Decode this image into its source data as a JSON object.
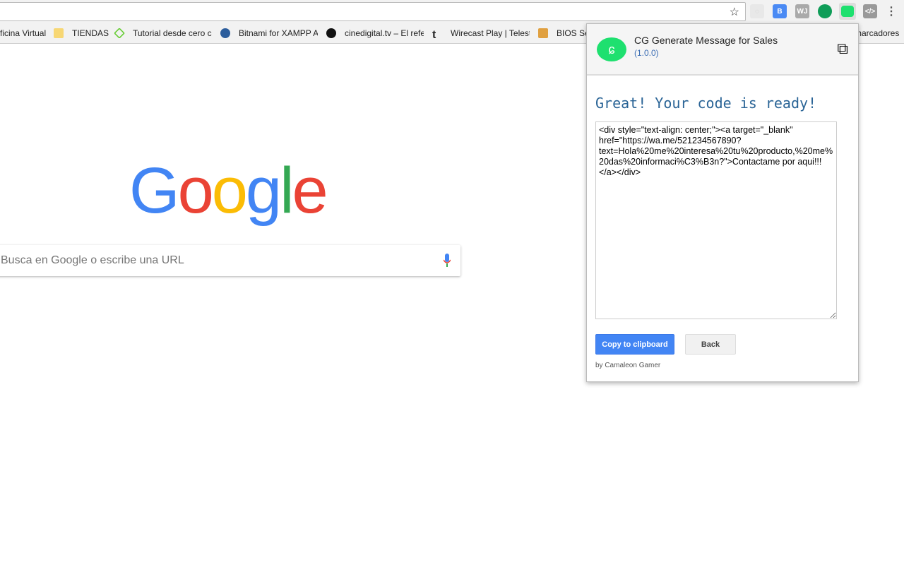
{
  "bookmarks": [
    {
      "label": "ficina Virtual",
      "icon": "bookmark-icon"
    },
    {
      "label": "TIENDAS",
      "icon": "folder-icon"
    },
    {
      "label": "Tutorial desde cero c",
      "icon": "site-icon"
    },
    {
      "label": "Bitnami for XAMPP A",
      "icon": "bitnami-icon"
    },
    {
      "label": "cinedigital.tv – El refe",
      "icon": "site-icon"
    },
    {
      "label": "Wirecast Play | Telest",
      "icon": "telestream-icon"
    },
    {
      "label": "BIOS Se",
      "icon": "site-icon"
    },
    {
      "label": "marcadores",
      "icon": "folder-icon"
    }
  ],
  "search": {
    "placeholder": "Busca en Google o escribe una URL"
  },
  "popup": {
    "title": "CG Generate Message for Sales",
    "version": "(1.0.0)",
    "heading": "Great! Your code is ready!",
    "code": "<div style=\"text-align: center;\"><a target=\"_blank\" href=\"https://wa.me/521234567890?text=Hola%20me%20interesa%20tu%20producto,%20me%20das%20informaci%C3%B3n?\">Contactame por aqui!!!</a></div>",
    "copy_label": "Copy to clipboard",
    "back_label": "Back",
    "footer": "by Camaleon Gamer",
    "accent": "#1ee06f"
  },
  "logo": "Google"
}
